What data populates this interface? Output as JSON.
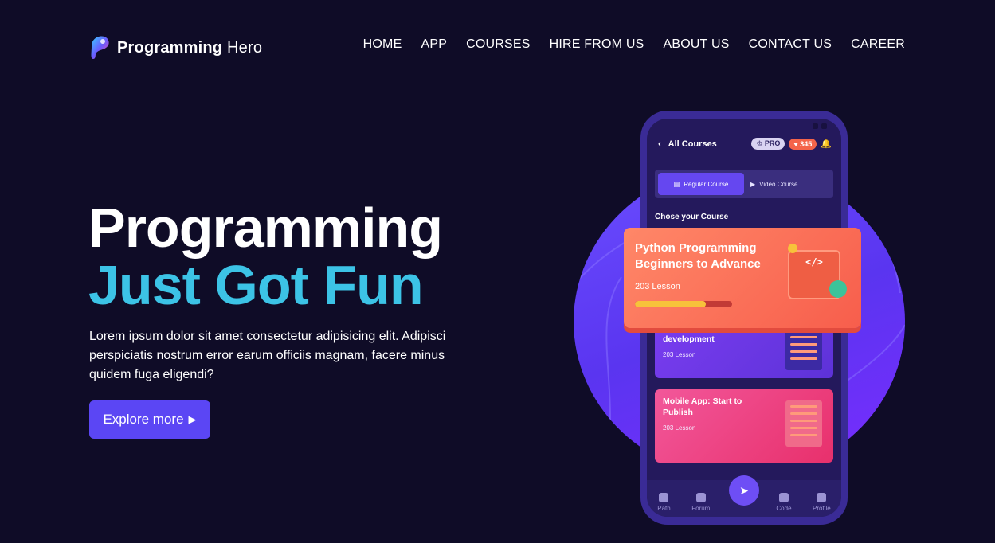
{
  "brand": {
    "name_bold": "Programming",
    "name_light": "Hero"
  },
  "nav": [
    "HOME",
    "APP",
    "COURSES",
    "HIRE FROM US",
    "ABOUT US",
    "CONTACT US",
    "CAREER"
  ],
  "hero": {
    "title_line1": "Programming",
    "title_line2": "Just Got Fun",
    "description": "Lorem ipsum dolor sit amet consectetur adipisicing elit. Adipisci perspiciatis nostrum error earum officiis magnam, facere minus quidem fuga eligendi?",
    "cta_label": "Explore more",
    "cta_icon": "play-triangle-icon"
  },
  "phone": {
    "header_title": "All Courses",
    "pro_badge": "PRO",
    "hearts_count": "345",
    "tab_regular": "Regular Course",
    "tab_video": "Video Course",
    "section_title": "Chose your Course",
    "courses": [
      {
        "title": "Python Programming Beginners to Advance",
        "lessons": "203 Lesson",
        "progress": 0.73
      },
      {
        "title": "Complete web development",
        "lessons": "203 Lesson"
      },
      {
        "title": "Mobile App: Start to Publish",
        "lessons": "203 Lesson"
      }
    ],
    "tabbar": [
      "Path",
      "Forum",
      "Code",
      "Profile"
    ]
  },
  "colors": {
    "background": "#0f0c27",
    "accent_cyan": "#3cc3e6",
    "cta_purple": "#5b46f4",
    "python_card": "#f75e4c"
  }
}
